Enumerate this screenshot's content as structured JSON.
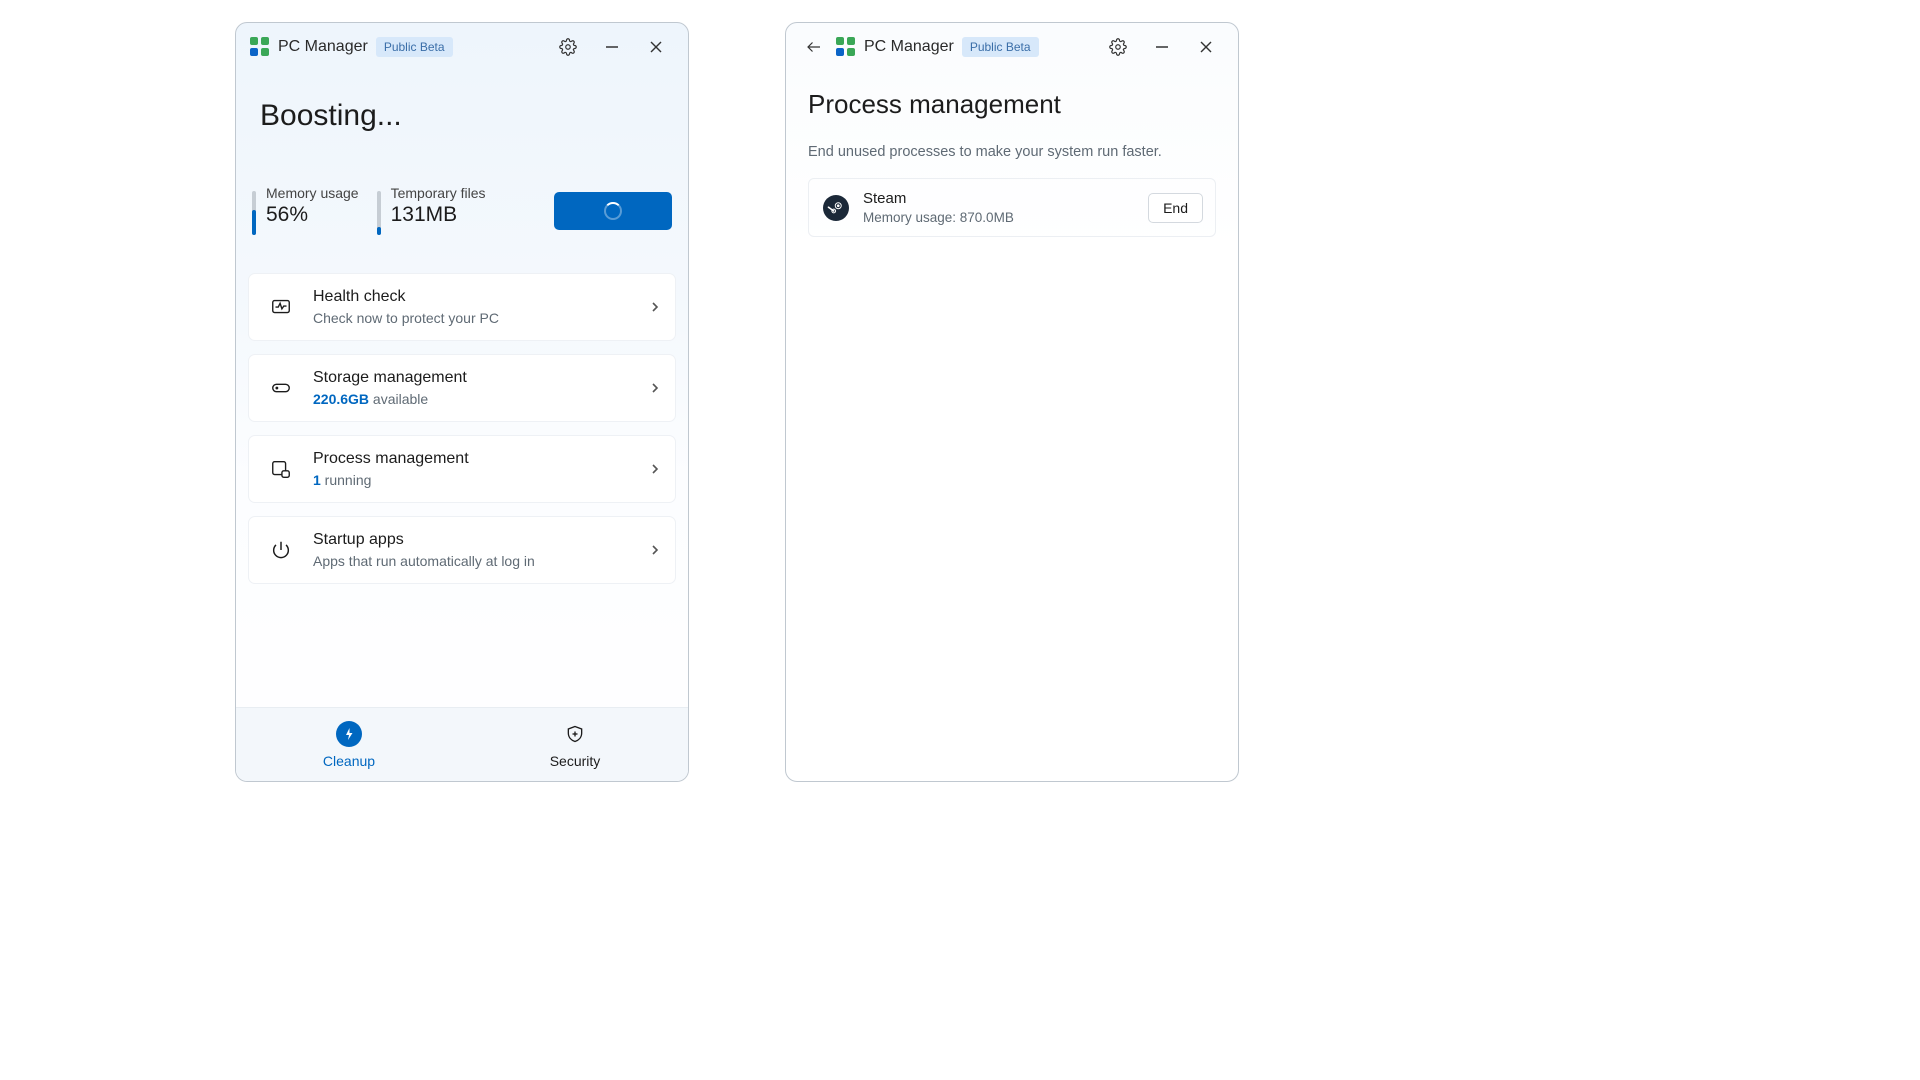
{
  "app": {
    "title": "PC Manager",
    "badge": "Public Beta"
  },
  "left": {
    "heading": "Boosting...",
    "memory": {
      "label": "Memory usage",
      "value": "56%",
      "fill_pct": 56
    },
    "temp": {
      "label": "Temporary files",
      "value": "131MB",
      "fill_pct": 18
    },
    "cards": {
      "health": {
        "title": "Health check",
        "sub": "Check now to protect your PC"
      },
      "storage": {
        "title": "Storage management",
        "free": "220.6GB",
        "suffix": " available"
      },
      "process": {
        "title": "Process management",
        "count": "1",
        "suffix": " running"
      },
      "startup": {
        "title": "Startup apps",
        "sub": "Apps that run automatically at log in"
      }
    },
    "nav": {
      "cleanup": "Cleanup",
      "security": "Security"
    }
  },
  "right": {
    "heading": "Process management",
    "desc": "End unused processes to make your system run faster.",
    "process": {
      "name": "Steam",
      "mem": "Memory usage: 870.0MB",
      "end_label": "End"
    }
  }
}
